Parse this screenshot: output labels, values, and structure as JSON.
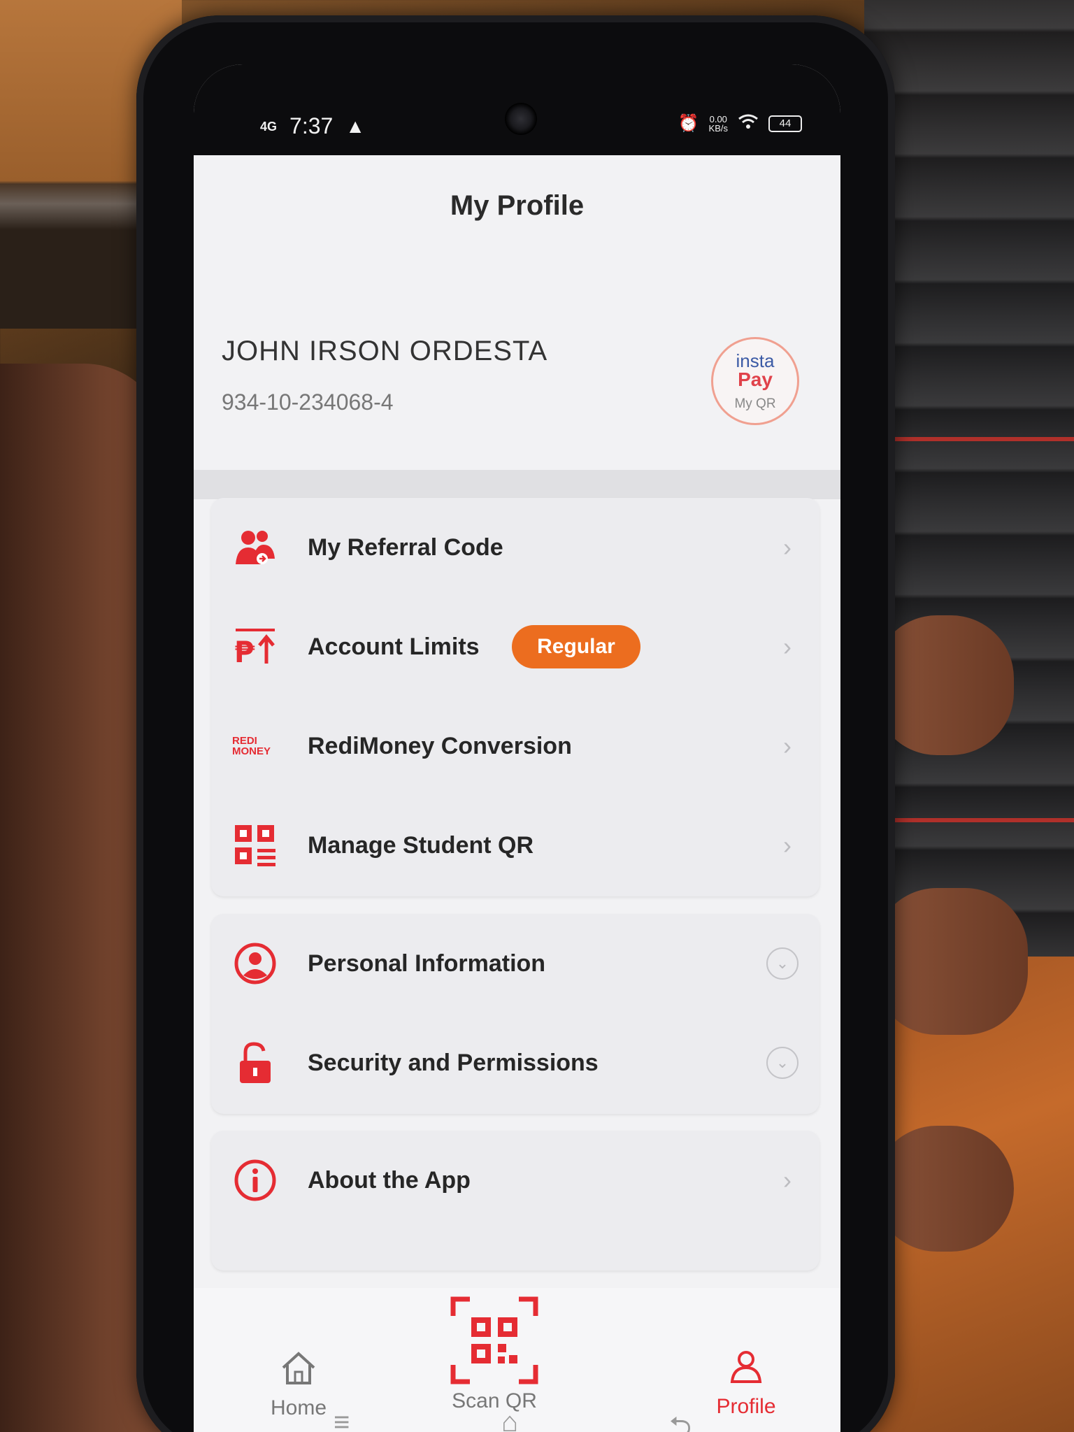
{
  "status_bar": {
    "network": "4G",
    "time": "7:37",
    "warning_icon": "warning-triangle-icon",
    "speed_value": "0.00",
    "speed_unit": "KB/s",
    "battery": "44"
  },
  "header": {
    "title": "My Profile"
  },
  "user": {
    "name": "JOHN IRSON ORDESTA",
    "account_number": "934-10-234068-4",
    "qr_badge": {
      "line1": "insta",
      "line2": "Pay",
      "caption": "My QR"
    }
  },
  "menu_group_1": [
    {
      "label": "My Referral Code",
      "icon": "referral-people-icon"
    },
    {
      "label": "Account Limits",
      "icon": "peso-up-arrow-icon",
      "badge": "Regular"
    },
    {
      "label": "RediMoney Conversion",
      "icon": "redimoney-logo-icon",
      "icon_text_1": "REDI",
      "icon_text_2": "MONEY"
    },
    {
      "label": "Manage Student QR",
      "icon": "qr-list-icon"
    }
  ],
  "menu_group_2": [
    {
      "label": "Personal Information",
      "icon": "user-circle-icon"
    },
    {
      "label": "Security and Permissions",
      "icon": "unlock-icon"
    }
  ],
  "menu_group_3": [
    {
      "label": "About the App",
      "icon": "info-circle-icon"
    }
  ],
  "bottom_nav": {
    "home": "Home",
    "scan": "Scan QR",
    "profile": "Profile",
    "active": "Profile"
  },
  "colors": {
    "accent": "#e52c33",
    "badge": "#ec6d1f"
  }
}
